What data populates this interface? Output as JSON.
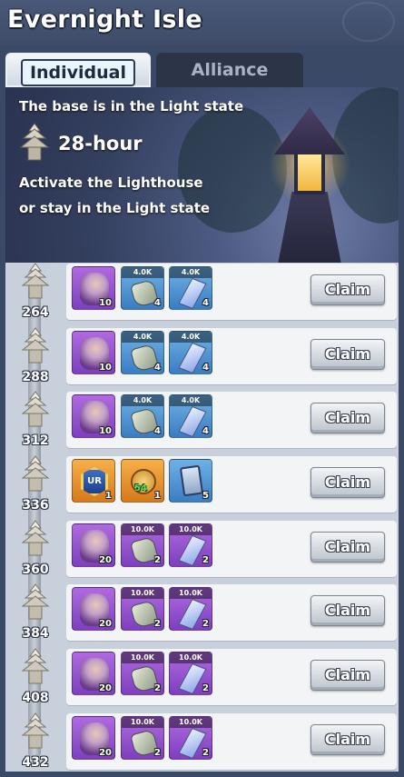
{
  "header": {
    "title": "Evernight Isle"
  },
  "tabs": [
    {
      "label": "Individual",
      "active": true
    },
    {
      "label": "Alliance",
      "active": false
    }
  ],
  "banner": {
    "line1": "The base is in the Light state",
    "hours": "28-hour",
    "line2": "Activate the Lighthouse",
    "line3": "or stay in the Light state"
  },
  "rows": [
    {
      "milestone": "264",
      "items": [
        {
          "icon": "hero-portrait",
          "color": "purple",
          "qty": "10"
        },
        {
          "icon": "ore-icon",
          "color": "blue",
          "amount": "4.0K",
          "qty": "4"
        },
        {
          "icon": "crystal-icon",
          "color": "blue",
          "amount": "4.0K",
          "qty": "4"
        }
      ],
      "button": "Claim"
    },
    {
      "milestone": "288",
      "items": [
        {
          "icon": "hero-portrait",
          "color": "purple",
          "qty": "10"
        },
        {
          "icon": "ore-icon",
          "color": "blue",
          "amount": "4.0K",
          "qty": "4"
        },
        {
          "icon": "crystal-icon",
          "color": "blue",
          "amount": "4.0K",
          "qty": "4"
        }
      ],
      "button": "Claim"
    },
    {
      "milestone": "312",
      "items": [
        {
          "icon": "hero-portrait",
          "color": "purple",
          "qty": "10"
        },
        {
          "icon": "ore-icon",
          "color": "blue",
          "amount": "4.0K",
          "qty": "4"
        },
        {
          "icon": "crystal-icon",
          "color": "blue",
          "amount": "4.0K",
          "qty": "4"
        }
      ],
      "button": "Claim"
    },
    {
      "milestone": "336",
      "items": [
        {
          "icon": "ur-badge-icon",
          "color": "orange",
          "label": "UR",
          "qty": "1"
        },
        {
          "icon": "token-icon",
          "color": "orange",
          "badge": "54",
          "qty": "1"
        },
        {
          "icon": "card-icon",
          "color": "blue",
          "qty": "5"
        }
      ],
      "button": "Claim"
    },
    {
      "milestone": "360",
      "items": [
        {
          "icon": "hero-portrait",
          "color": "purple",
          "qty": "20"
        },
        {
          "icon": "ore-icon",
          "color": "purple",
          "amount": "10.0K",
          "qty": "2"
        },
        {
          "icon": "crystal-icon",
          "color": "purple",
          "amount": "10.0K",
          "qty": "2"
        }
      ],
      "button": "Claim"
    },
    {
      "milestone": "384",
      "items": [
        {
          "icon": "hero-portrait",
          "color": "purple",
          "qty": "20"
        },
        {
          "icon": "ore-icon",
          "color": "purple",
          "amount": "10.0K",
          "qty": "2"
        },
        {
          "icon": "crystal-icon",
          "color": "purple",
          "amount": "10.0K",
          "qty": "2"
        }
      ],
      "button": "Claim"
    },
    {
      "milestone": "408",
      "items": [
        {
          "icon": "hero-portrait",
          "color": "purple",
          "qty": "20"
        },
        {
          "icon": "ore-icon",
          "color": "purple",
          "amount": "10.0K",
          "qty": "2"
        },
        {
          "icon": "crystal-icon",
          "color": "purple",
          "amount": "10.0K",
          "qty": "2"
        }
      ],
      "button": "Claim"
    },
    {
      "milestone": "432",
      "items": [
        {
          "icon": "hero-portrait",
          "color": "purple",
          "qty": "20"
        },
        {
          "icon": "ore-icon",
          "color": "purple",
          "amount": "10.0K",
          "qty": "2"
        },
        {
          "icon": "crystal-icon",
          "color": "purple",
          "amount": "10.0K",
          "qty": "2"
        }
      ],
      "button": "Claim"
    }
  ]
}
